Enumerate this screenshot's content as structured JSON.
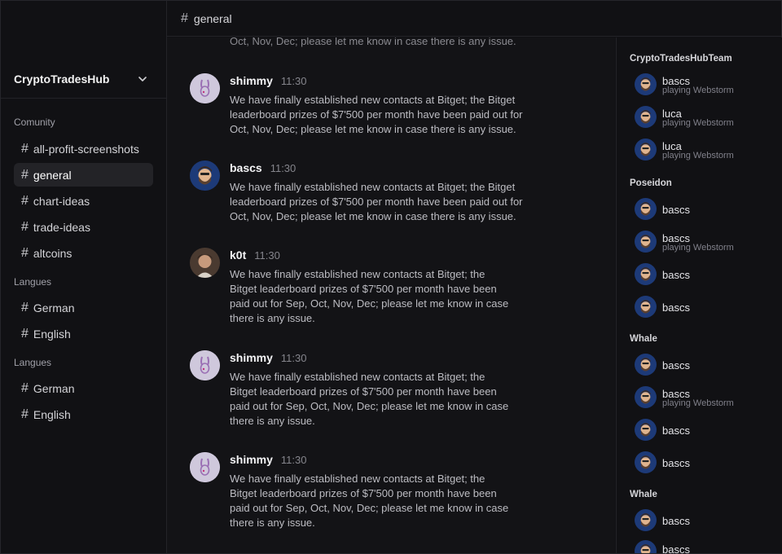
{
  "server": {
    "name": "CryptoTradesHub"
  },
  "channel_groups": [
    {
      "label": "Comunity",
      "channels": [
        "all-profit-screenshots",
        "general",
        "chart-ideas",
        "trade-ideas",
        "altcoins"
      ]
    },
    {
      "label": "Langues",
      "channels": [
        "German",
        "English"
      ]
    },
    {
      "label": "Langues",
      "channels": [
        "German",
        "English"
      ]
    }
  ],
  "active_channel": "general",
  "topbar": {
    "title": "general"
  },
  "cut_off_text": "Oct, Nov, Dec; please let me know in case there is any issue.",
  "messages": [
    {
      "author": "shimmy",
      "time": "11:30",
      "avatar": "rabbit",
      "lines": [
        "We have finally established new contacts at Bitget; the Bitget",
        "leaderboard prizes of $7'500 per month have been paid out for",
        "Oct, Nov, Dec; please let me know in case there is any issue."
      ]
    },
    {
      "author": "bascs",
      "time": "11:30",
      "avatar": "bearded",
      "lines": [
        "We have finally established new contacts at Bitget; the Bitget",
        "leaderboard prizes of $7'500 per month have been paid out for",
        "Oct, Nov, Dec; please let me know in case there is any issue."
      ]
    },
    {
      "author": "k0t",
      "time": "11:30",
      "avatar": "photo",
      "lines": [
        "We have finally established new contacts at Bitget; the",
        "Bitget leaderboard prizes of $7'500 per month have been",
        "paid out for Sep, Oct, Nov, Dec; please let me know in case",
        "there is any issue."
      ]
    },
    {
      "author": "shimmy",
      "time": "11:30",
      "avatar": "rabbit",
      "lines": [
        "We have finally established new contacts at Bitget; the",
        "Bitget leaderboard prizes of $7'500 per month have been",
        "paid out for Sep, Oct, Nov, Dec; please let me know in case",
        "there is any issue."
      ]
    },
    {
      "author": "shimmy",
      "time": "11:30",
      "avatar": "rabbit",
      "lines": [
        "We have finally established new contacts at Bitget; the",
        "Bitget leaderboard prizes of $7'500 per month have been",
        "paid out for Sep, Oct, Nov, Dec; please let me know in case",
        "there is any issue."
      ]
    }
  ],
  "member_groups": [
    {
      "label": "CryptoTradesHubTeam",
      "members": [
        {
          "name": "bascs",
          "status": "playing Webstorm"
        },
        {
          "name": "luca",
          "status": "playing Webstorm"
        },
        {
          "name": "luca",
          "status": "playing Webstorm"
        }
      ]
    },
    {
      "label": "Poseidon",
      "members": [
        {
          "name": "bascs",
          "status": ""
        },
        {
          "name": "bascs",
          "status": "playing Webstorm"
        },
        {
          "name": "bascs",
          "status": ""
        },
        {
          "name": "bascs",
          "status": ""
        }
      ]
    },
    {
      "label": "Whale",
      "members": [
        {
          "name": "bascs",
          "status": ""
        },
        {
          "name": "bascs",
          "status": "playing Webstorm"
        },
        {
          "name": "bascs",
          "status": ""
        },
        {
          "name": "bascs",
          "status": ""
        }
      ]
    },
    {
      "label": "Whale",
      "members": [
        {
          "name": "bascs",
          "status": ""
        },
        {
          "name": "bascs",
          "status": ""
        }
      ]
    }
  ],
  "colors": {
    "background": "#111114",
    "active_channel_bg": "#232327",
    "text_muted": "#85858c"
  },
  "icons": {
    "hash": "hash-icon",
    "chevron": "chevron-down-icon"
  }
}
